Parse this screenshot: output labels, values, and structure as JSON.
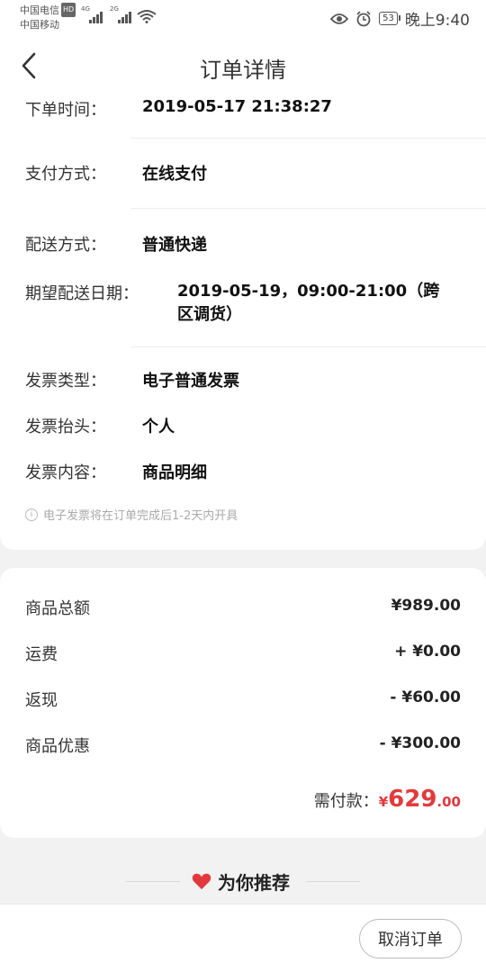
{
  "status_bar": {
    "carrier1": "中国电信",
    "carrier1_badge": "HD",
    "carrier2": "中国移动",
    "net1": "4G",
    "net2": "2G",
    "battery": "53",
    "time": "晚上9:40"
  },
  "header": {
    "title": "订单详情",
    "back_icon": "chevron-left-icon"
  },
  "order_info": {
    "order_time_label": "下单时间：",
    "order_time_value": "2019-05-17 21:38:27",
    "payment_label": "支付方式：",
    "payment_value": "在线支付",
    "delivery_label": "配送方式：",
    "delivery_value": "普通快递",
    "expected_date_label": "期望配送日期：",
    "expected_date_value": "2019-05-19，09:00-21:00（跨区调货）",
    "invoice_type_label": "发票类型：",
    "invoice_type_value": "电子普通发票",
    "invoice_title_label": "发票抬头：",
    "invoice_title_value": "个人",
    "invoice_content_label": "发票内容：",
    "invoice_content_value": "商品明细",
    "invoice_note": "电子发票将在订单完成后1-2天内开具"
  },
  "price": {
    "goods_total_label": "商品总额",
    "goods_total_value": "¥989.00",
    "shipping_label": "运费",
    "shipping_value": "+ ¥0.00",
    "cashback_label": "返现",
    "cashback_value": "- ¥60.00",
    "discount_label": "商品优惠",
    "discount_value": "- ¥300.00",
    "payable_label": "需付款：",
    "payable_currency": "¥",
    "payable_integer": "629",
    "payable_cents": ".00"
  },
  "recommend": {
    "title": "为你推荐"
  },
  "actions": {
    "cancel_label": "取消订单"
  },
  "colors": {
    "accent": "#e4393c",
    "background": "#f2f2f2"
  }
}
